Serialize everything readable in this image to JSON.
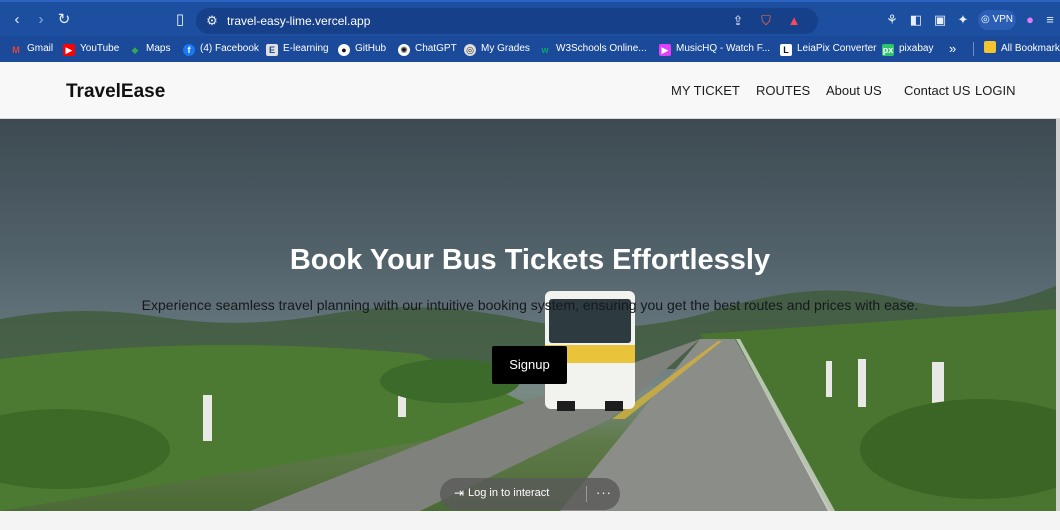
{
  "browser": {
    "url": "travel-easy-lime.vercel.app",
    "vpn_label": "VPN",
    "nav_icons": [
      "back-icon",
      "forward-icon",
      "reload-icon",
      "bookmark-icon",
      "site-settings-icon",
      "share-icon",
      "brave-shield-icon",
      "brave-rewards-icon",
      "extensions-icon",
      "sidebar-icon",
      "wallet-icon",
      "leo-ai-icon",
      "profile-icon",
      "menu-icon"
    ]
  },
  "bookmarks": {
    "items": [
      {
        "label": "Gmail",
        "icon": "gmail-icon",
        "color": "#ea4335"
      },
      {
        "label": "YouTube",
        "icon": "youtube-icon",
        "color": "#ff0000"
      },
      {
        "label": "Maps",
        "icon": "maps-icon",
        "color": "#34a853"
      },
      {
        "label": "(4) Facebook",
        "icon": "facebook-icon",
        "color": "#1877f2"
      },
      {
        "label": "E-learning",
        "icon": "elearning-icon",
        "color": "#e0e0e0"
      },
      {
        "label": "GitHub",
        "icon": "github-icon",
        "color": "#ffffff"
      },
      {
        "label": "ChatGPT",
        "icon": "chatgpt-icon",
        "color": "#ffffff"
      },
      {
        "label": "My Grades",
        "icon": "grades-icon",
        "color": "#dcdcdc"
      },
      {
        "label": "W3Schools Online...",
        "icon": "w3schools-icon",
        "color": "#04aa6d"
      },
      {
        "label": "MusicHQ - Watch F...",
        "icon": "musichq-icon",
        "color": "#e040fb"
      },
      {
        "label": "LeiaPix Converter",
        "icon": "leiapix-icon",
        "color": "#111111"
      },
      {
        "label": "pixabay",
        "icon": "pixabay-icon",
        "color": "#2ec66d"
      }
    ],
    "overflow_label": "»",
    "all_bookmarks_label": "All Bookmarks"
  },
  "header": {
    "brand": "TravelEase",
    "nav": [
      "MY TICKET",
      "ROUTES",
      "About US",
      "Contact US",
      "LOGIN"
    ]
  },
  "hero": {
    "title": "Book Your Bus Tickets Effortlessly",
    "subtitle": "Experience seamless travel planning with our intuitive booking system, ensuring you get the best routes and prices with ease.",
    "cta_label": "Signup"
  },
  "overlay": {
    "login_label": "Log in to interact",
    "more_label": "···"
  },
  "colors": {
    "chrome": "#1d4fa0",
    "bookmarks_bar": "#1a4a99",
    "header_bg": "#f8f8f8",
    "cta_bg": "#000000"
  }
}
